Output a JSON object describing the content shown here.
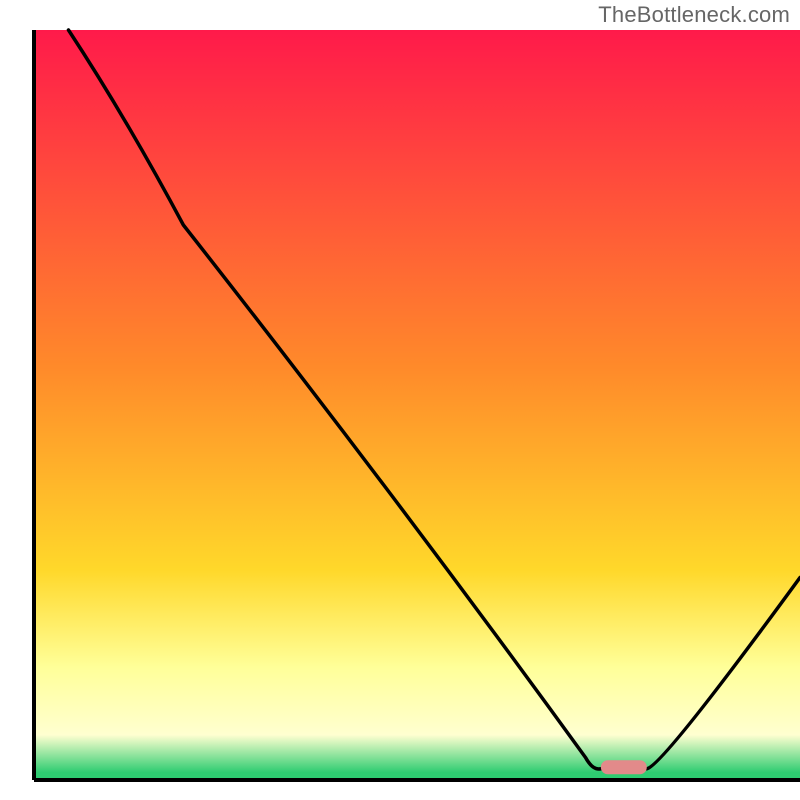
{
  "watermark": "TheBottleneck.com",
  "colors": {
    "curve_stroke": "#000000",
    "axis_stroke": "#000000",
    "marker_fill": "#e28a8a",
    "grad_top": "#ff1a4a",
    "grad_mid1": "#ff8a2a",
    "grad_mid2": "#ffd82a",
    "grad_low": "#ffff99",
    "grad_band": "#ffffd0",
    "grad_green": "#2ecc71"
  },
  "chart_data": {
    "type": "line",
    "title": "",
    "xlabel": "",
    "ylabel": "",
    "xlim": [
      0,
      100
    ],
    "ylim": [
      0,
      100
    ],
    "curve_points": [
      {
        "x": 4.5,
        "y": 100
      },
      {
        "x": 19.5,
        "y": 74
      },
      {
        "x": 72,
        "y": 3
      },
      {
        "x": 74,
        "y": 1.5
      },
      {
        "x": 80,
        "y": 1.5
      },
      {
        "x": 100,
        "y": 27
      }
    ],
    "marker": {
      "x_start": 74,
      "x_end": 80,
      "y": 1.7
    },
    "gradient_stops_pct": {
      "top_red": 0,
      "orange": 45,
      "yellow": 72,
      "pale": 85,
      "pale_band": 94,
      "green": 99,
      "bottom": 100
    }
  }
}
